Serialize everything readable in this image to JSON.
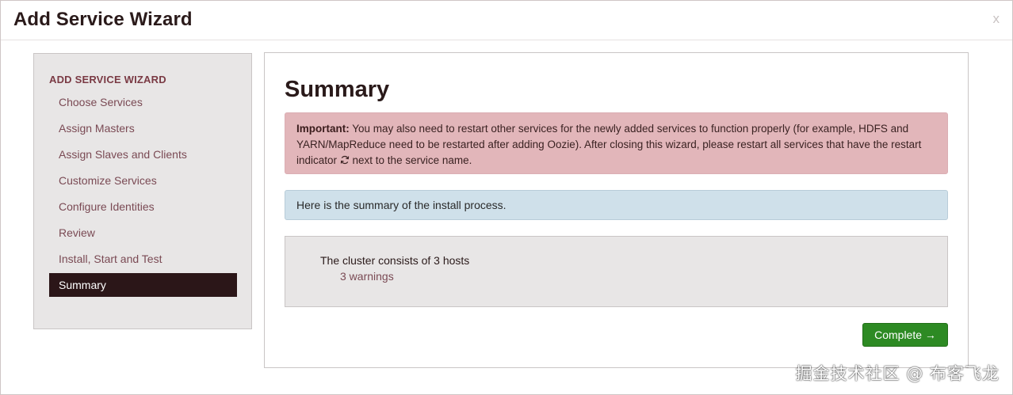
{
  "modal": {
    "title": "Add Service Wizard",
    "close_label": "x"
  },
  "sidebar": {
    "header": "ADD SERVICE WIZARD",
    "items": [
      {
        "label": "Choose Services"
      },
      {
        "label": "Assign Masters"
      },
      {
        "label": "Assign Slaves and Clients"
      },
      {
        "label": "Customize Services"
      },
      {
        "label": "Configure Identities"
      },
      {
        "label": "Review"
      },
      {
        "label": "Install, Start and Test"
      },
      {
        "label": "Summary",
        "active": true
      }
    ]
  },
  "main": {
    "title": "Summary",
    "important_label": "Important:",
    "important_text_before_icon": " You may also need to restart other services for the newly added services to function properly (for example, HDFS and YARN/MapReduce need to be restarted after adding Oozie). After closing this wizard, please restart all services that have the restart indicator ",
    "important_text_after_icon": " next to the service name.",
    "info_text": "Here is the summary of the install process.",
    "summary_line": "The cluster consists of 3 hosts",
    "warnings_link": "3 warnings",
    "complete_button": "Complete →"
  },
  "watermark": "掘金技术社区 @ 布客飞龙",
  "colors": {
    "active_sidebar_bg": "#2b1618",
    "important_bg": "#e2b6ba",
    "info_bg": "#cfe0ea",
    "complete_bg": "#2d8a23",
    "link_color": "#7a4a54"
  },
  "icons": {
    "restart": "refresh-icon",
    "close": "close-icon"
  }
}
